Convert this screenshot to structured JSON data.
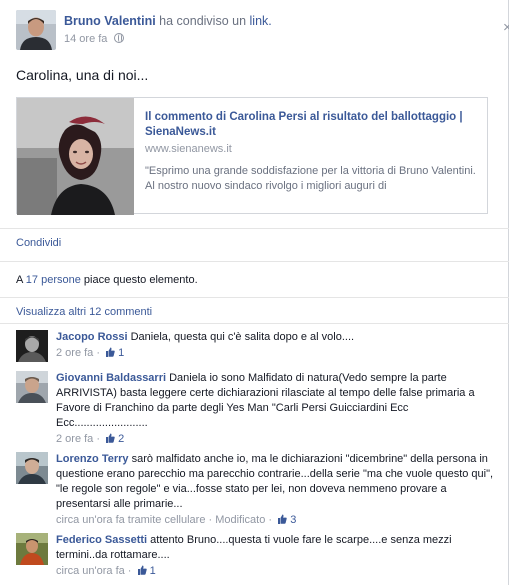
{
  "post": {
    "author": "Bruno Valentini",
    "action": "ha condiviso un",
    "object": "link.",
    "time": "14 ore fa",
    "message": "Carolina, una di noi...",
    "close_symbol": "×",
    "card": {
      "title": "Il commento di Carolina Persi al risultato del ballottaggio | SienaNews.it",
      "domain": "www.sienanews.it",
      "description": "\"Esprimo una grande soddisfazione per la vittoria di Bruno Valentini. Al nostro nuovo sindaco rivolgo i migliori auguri di"
    },
    "share_label": "Condividi",
    "likes": {
      "prefix": "A",
      "link": "17 persone",
      "suffix": "piace questo elemento."
    },
    "more_comments": "Visualizza altri 12 commenti"
  },
  "comments": [
    {
      "author": "Jacopo Rossi",
      "text": "Daniela, questa qui c'è salita dopo e al volo....",
      "time": "2 ore fa",
      "likes": "1"
    },
    {
      "author": "Giovanni Baldassarri",
      "text": "Daniela io sono Malfidato di natura(Vedo sempre la parte ARRIVISTA) basta leggere certe dichiarazioni rilasciate al tempo delle false primaria a Favore di Franchino da parte degli Yes Man \"Carli Persi Guicciardini Ecc Ecc........................",
      "time": "2 ore fa",
      "likes": "2"
    },
    {
      "author": "Lorenzo Terry",
      "text": "sarò malfidato anche io, ma le dichiarazioni \"dicembrine\" della persona in questione erano parecchio ma parecchio contrarie...della serie \"ma che vuole questo qui\", \"le regole son regole\" e via...fosse stato per lei, non doveva nemmeno provare a presentarsi alle primarie...",
      "time": "circa un'ora fa tramite cellulare · Modificato ·",
      "likes": "3"
    },
    {
      "author": "Federico Sassetti",
      "text": "attento Bruno....questa ti vuole fare le scarpe....e senza mezzi termini..da rottamare....",
      "time": "circa un'ora fa",
      "likes": "1"
    }
  ]
}
